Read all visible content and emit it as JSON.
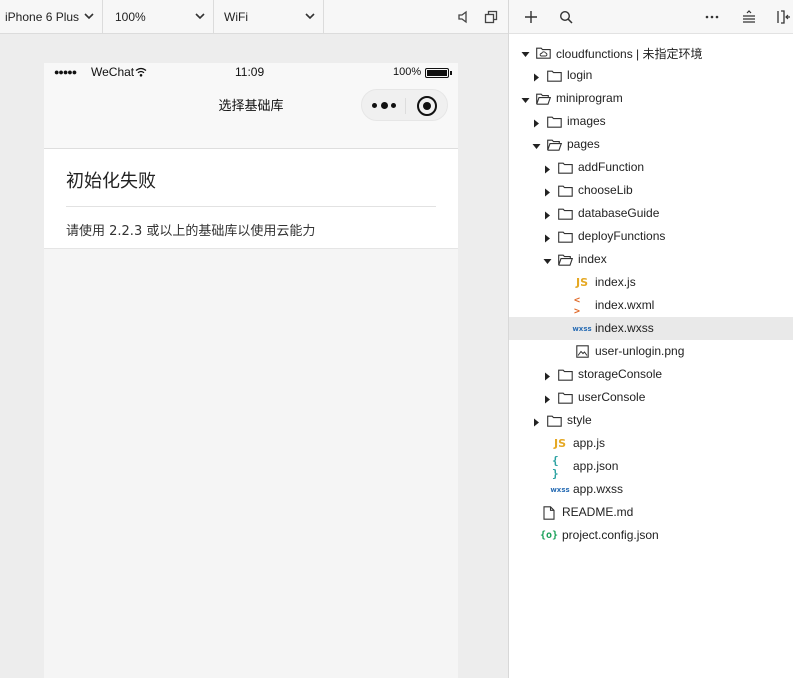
{
  "toolbar": {
    "device": "iPhone 6 Plus",
    "zoom": "100%",
    "network": "WiFi"
  },
  "phone": {
    "status": {
      "signal": "●●●●●",
      "carrier": "WeChat",
      "time": "11:09",
      "battery_text": "100%",
      "battery_level": 1.0
    },
    "nav_title": "选择基础库",
    "card": {
      "title": "初始化失败",
      "message": "请使用 2.2.3 或以上的基础库以使用云能力"
    }
  },
  "tree": {
    "items": [
      {
        "label": "cloudfunctions | 未指定环境",
        "kind": "cloud-folder",
        "expanded": true
      },
      {
        "label": "login",
        "kind": "folder",
        "expanded": false
      },
      {
        "label": "miniprogram",
        "kind": "folder",
        "expanded": true
      },
      {
        "label": "images",
        "kind": "folder",
        "expanded": false
      },
      {
        "label": "pages",
        "kind": "folder",
        "expanded": true
      },
      {
        "label": "addFunction",
        "kind": "folder",
        "expanded": false
      },
      {
        "label": "chooseLib",
        "kind": "folder",
        "expanded": false
      },
      {
        "label": "databaseGuide",
        "kind": "folder",
        "expanded": false
      },
      {
        "label": "deployFunctions",
        "kind": "folder",
        "expanded": false
      },
      {
        "label": "index",
        "kind": "folder",
        "expanded": true
      },
      {
        "label": "index.js",
        "kind": "js"
      },
      {
        "label": "index.wxml",
        "kind": "wxml"
      },
      {
        "label": "index.wxss",
        "kind": "wxss",
        "selected": true
      },
      {
        "label": "user-unlogin.png",
        "kind": "image"
      },
      {
        "label": "storageConsole",
        "kind": "folder",
        "expanded": false
      },
      {
        "label": "userConsole",
        "kind": "folder",
        "expanded": false
      },
      {
        "label": "style",
        "kind": "folder",
        "expanded": false
      },
      {
        "label": "app.js",
        "kind": "js"
      },
      {
        "label": "app.json",
        "kind": "json"
      },
      {
        "label": "app.wxss",
        "kind": "wxss"
      },
      {
        "label": "README.md",
        "kind": "file"
      },
      {
        "label": "project.config.json",
        "kind": "config"
      }
    ]
  },
  "icons": {
    "js": "JS",
    "wxml": "< >",
    "wxss": "wxss",
    "json": "{ }",
    "config": "{o}"
  }
}
